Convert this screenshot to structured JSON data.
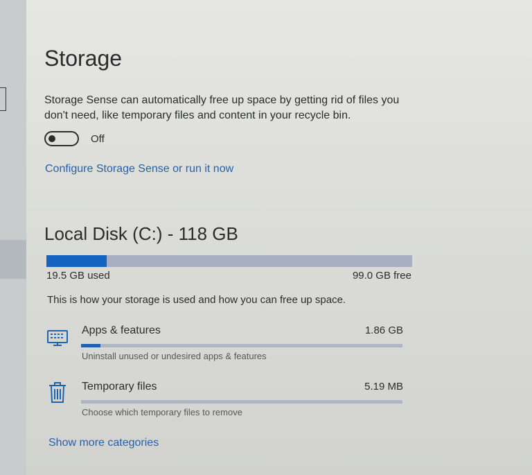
{
  "page": {
    "title": "Storage"
  },
  "storage_sense": {
    "description": "Storage Sense can automatically free up space by getting rid of files you don't need, like temporary files and content in your recycle bin.",
    "toggle_state": "Off",
    "toggle_on": false,
    "configure_link": "Configure Storage Sense or run it now"
  },
  "disk": {
    "title": "Local Disk (C:) - 118 GB",
    "used_label": "19.5 GB used",
    "free_label": "99.0 GB free",
    "used_fraction": 0.165,
    "usage_description": "This is how your storage is used and how you can free up space."
  },
  "categories": [
    {
      "name": "Apps & features",
      "size": "1.86 GB",
      "subtitle": "Uninstall unused or undesired apps & features",
      "fraction": 0.06,
      "icon": "monitor-icon"
    },
    {
      "name": "Temporary files",
      "size": "5.19 MB",
      "subtitle": "Choose which temporary files to remove",
      "fraction": 0.0,
      "icon": "trash-icon"
    }
  ],
  "show_more_link": "Show more categories",
  "colors": {
    "accent": "#1463c0",
    "link": "#2861a6",
    "bar_track": "#a7afc0"
  }
}
